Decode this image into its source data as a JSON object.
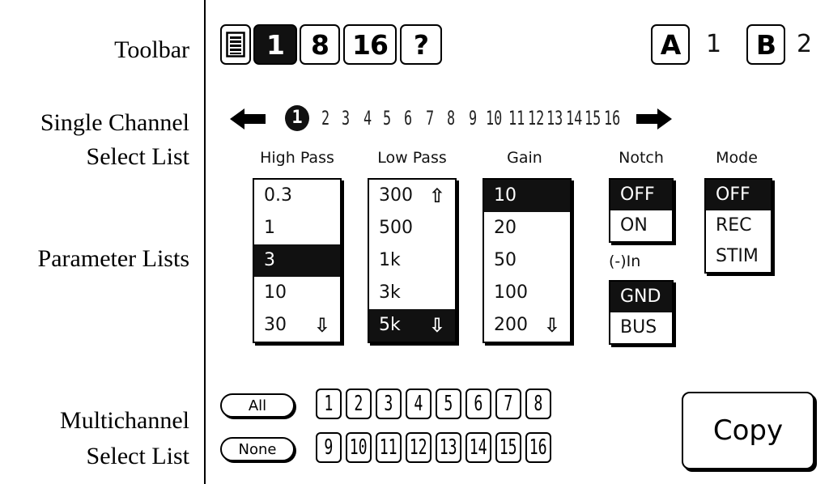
{
  "annotations": {
    "toolbar": "Toolbar",
    "single_channel_1": "Single Channel",
    "single_channel_2": "Select List",
    "parameter_lists": "Parameter Lists",
    "multichannel_1": "Multichannel",
    "multichannel_2": "Select  List"
  },
  "toolbar": {
    "page_icon": "document-icon",
    "btn_1": "1",
    "btn_8": "8",
    "btn_16": "16",
    "help": "?",
    "a_label": "A",
    "a_value": "1",
    "b_label": "B",
    "b_value": "2"
  },
  "channels": {
    "left_arrow": "left-arrow-icon",
    "right_arrow": "right-arrow-icon",
    "items": [
      "1",
      "2",
      "3",
      "4",
      "5",
      "6",
      "7",
      "8",
      "9",
      "10",
      "11",
      "12",
      "13",
      "14",
      "15",
      "16"
    ],
    "selected": "1"
  },
  "params": {
    "high_pass": {
      "label": "High Pass",
      "items": [
        "0.3",
        "1",
        "3",
        "10",
        "30"
      ],
      "selected": "3"
    },
    "low_pass": {
      "label": "Low Pass",
      "items": [
        "300",
        "500",
        "1k",
        "3k",
        "5k"
      ],
      "selected": "5k"
    },
    "gain": {
      "label": "Gain",
      "items": [
        "10",
        "20",
        "50",
        "100",
        "200"
      ],
      "selected": "10"
    },
    "notch": {
      "label": "Notch",
      "items": [
        "OFF",
        "ON"
      ],
      "selected": "OFF"
    },
    "neg_in": {
      "label": "(-)In",
      "items": [
        "GND",
        "BUS"
      ],
      "selected": "GND"
    },
    "mode": {
      "label": "Mode",
      "items": [
        "OFF",
        "REC",
        "STIM"
      ],
      "selected": "OFF"
    }
  },
  "multichannel": {
    "all": "All",
    "none": "None",
    "row1": [
      "1",
      "2",
      "3",
      "4",
      "5",
      "6",
      "7",
      "8"
    ],
    "row2": [
      "9",
      "10",
      "11",
      "12",
      "13",
      "14",
      "15",
      "16"
    ],
    "copy": "Copy"
  }
}
